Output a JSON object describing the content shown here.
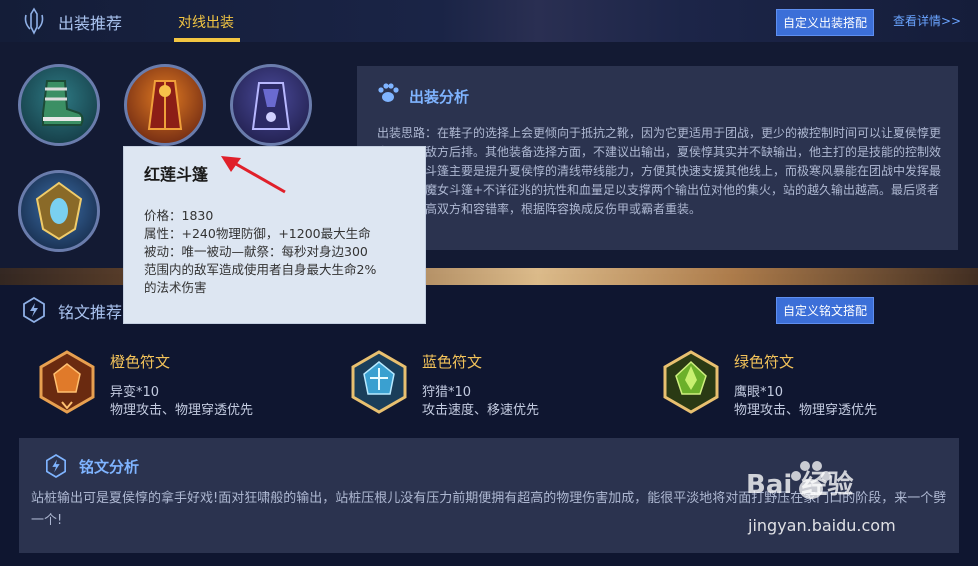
{
  "header": {
    "section_title": "出装推荐",
    "tab_label": "对线出装",
    "custom_build_button": "自定义出装搭配",
    "view_details_link": "查看详情>>"
  },
  "items": {
    "icons": [
      "boots-item-icon",
      "crimson-cloak-item-icon",
      "witch-cloak-item-icon",
      "sage-protection-item-icon"
    ]
  },
  "analysis": {
    "title": "出装分析",
    "text": "出装思路：在鞋子的选择上会更倾向于抵抗之靴，因为它更适用于团战，更少的被控制时间可以让夏侯惇更容易切入敌方后排。其他装备选择方面，不建议出输出，夏侯惇其实并不缺输出，他主打的是技能的控制效果，红莲斗篷主要是提升夏侯惇的清线带线能力，方便其快速支援其他线上，而极寒风暴能在团战中发挥最大作用。魔女斗篷+不详征兆的抗性和血量足以支撑两个输出位对他的集火，站的越久输出越高。最后贤者的庇护提高双方和容错率，根据阵容换成反伤甲或霸者重装。"
  },
  "tooltip": {
    "name": "红莲斗篷",
    "price": "价格：1830",
    "attributes": "属性：+240物理防御，+1200最大生命",
    "passive_line1": "被动：唯一被动—献祭：每秒对身边300",
    "passive_line2": "范围内的敌军造成使用者自身最大生命2%",
    "passive_line3": "的法术伤害"
  },
  "runes": {
    "section_title": "铭文推荐",
    "custom_rune_button": "自定义铭文搭配",
    "list": [
      {
        "name": "橙色符文",
        "rune": "异变*10",
        "desc": "物理攻击、物理穿透优先",
        "color": "#e07a2a"
      },
      {
        "name": "蓝色符文",
        "rune": "狩猎*10",
        "desc": "攻击速度、移速优先",
        "color": "#3aa0d0"
      },
      {
        "name": "绿色符文",
        "rune": "鹰眼*10",
        "desc": "物理攻击、物理穿透优先",
        "color": "#6cb02a"
      }
    ]
  },
  "rune_analysis": {
    "title": "铭文分析",
    "text": "站桩输出可是夏侯惇的拿手好戏!面对狂啸般的输出，站桩压根儿没有压力前期便拥有超高的物理伤害加成，能很平淡地将对面打野压在家门口的阶段，来一个劈一个!"
  },
  "watermark": {
    "brand": "Bai 经验",
    "url": "jingyan.baidu.com"
  },
  "colors": {
    "accent_gold": "#f2c542",
    "accent_blue": "#3c6fd8",
    "panel": "#2b334f"
  }
}
